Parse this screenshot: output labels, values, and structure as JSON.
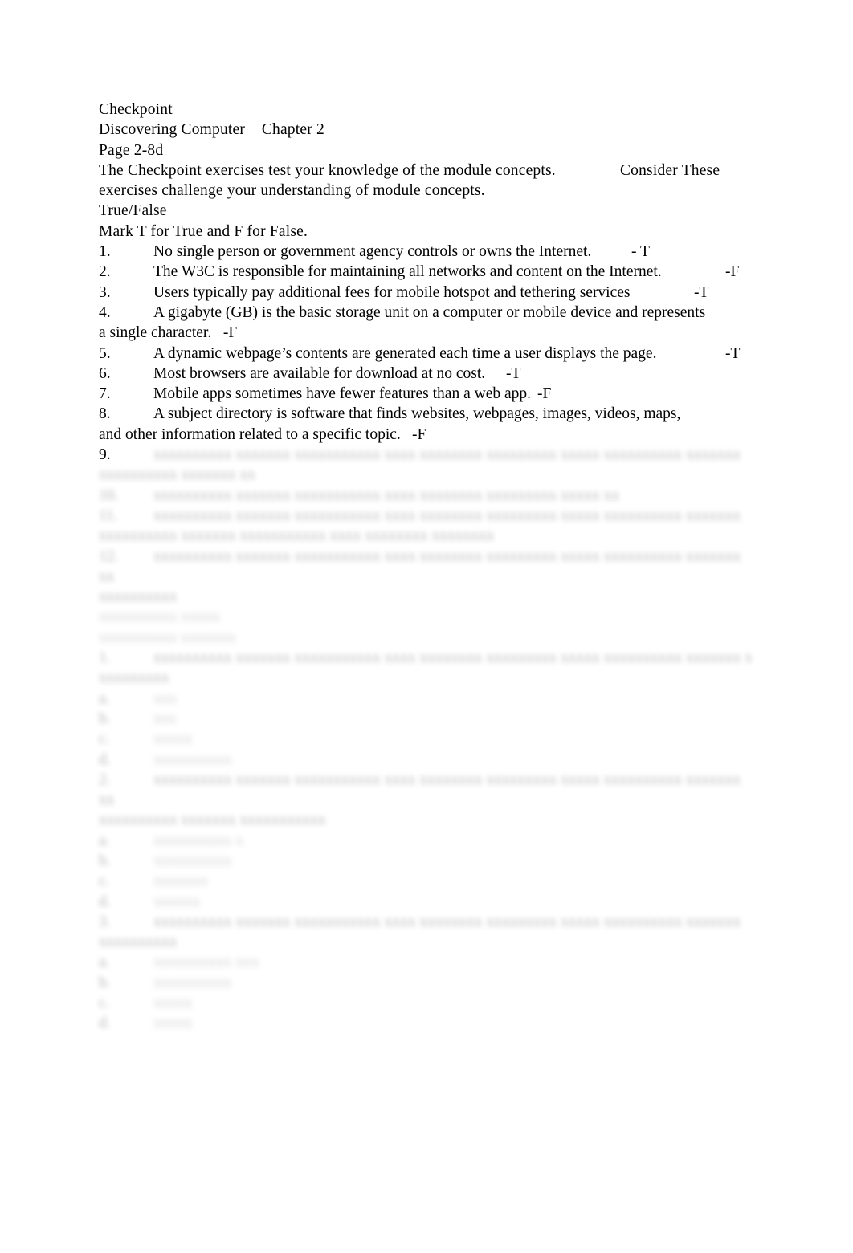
{
  "document": {
    "title_lines": [
      "Checkpoint",
      "Discovering Computer\tChapter 2",
      "Page 2-8d"
    ],
    "intro": [
      "The Checkpoint exercises test your knowledge of the module concepts.\t\tConsider These",
      "exercises challenge your understanding of module concepts."
    ],
    "section_true_false": {
      "heading": "True/False",
      "instruction": "Mark T for True and F for False.",
      "items": [
        {
          "number": "1.",
          "text": "No single person or government agency controls or owns the Internet.",
          "answer": "- T",
          "gap": "\t\t",
          "continuation": ""
        },
        {
          "number": "2.",
          "text": "The W3C is responsible for maintaining all networks and content on the Internet.",
          "answer": "-F",
          "gap": "\t\t",
          "continuation": ""
        },
        {
          "number": "3.",
          "text": "Users typically pay additional fees for mobile hotspot and tethering services",
          "answer": "-T",
          "gap": "\t\t",
          "continuation": ""
        },
        {
          "number": "4.",
          "text": "A gigabyte (GB) is the basic storage unit on a computer or mobile device and represents",
          "answer": "",
          "gap": "",
          "continuation": "a single character.   -F"
        },
        {
          "number": "5.",
          "text": "A dynamic webpage’s contents are generated each time a user displays the page.",
          "answer": "-T",
          "gap": "\t\t\t",
          "continuation": ""
        },
        {
          "number": "6.",
          "text": "Most browsers are available for download at no cost.",
          "answer": "-T",
          "gap": "\t",
          "continuation": ""
        },
        {
          "number": "7.",
          "text": "Mobile apps sometimes have fewer features than a web app.",
          "answer": "-F",
          "gap": "\t",
          "continuation": ""
        },
        {
          "number": "8.",
          "text": "A subject directory is software that finds websites, webpages, images, videos, maps,",
          "answer": "",
          "gap": "",
          "continuation": "and other information related to a specific topic.\t-F"
        }
      ]
    },
    "obscured_region": {
      "note_visible_number": "9.",
      "lines": [
        {
          "indent": "hanging",
          "number": "9.",
          "width": "92%",
          "level": "blur"
        },
        {
          "indent": "margin",
          "number": "",
          "width": "22%",
          "level": "blur"
        },
        {
          "indent": "hanging",
          "number": "10.",
          "width": "72%",
          "level": "blur"
        },
        {
          "indent": "hanging",
          "number": "11.",
          "width": "92%",
          "level": "blur"
        },
        {
          "indent": "margin",
          "number": "",
          "width": "56%",
          "level": "blur"
        },
        {
          "indent": "hanging",
          "number": "12.",
          "width": "94%",
          "level": "blur"
        },
        {
          "indent": "margin",
          "number": "",
          "width": "12%",
          "level": "blur"
        },
        {
          "indent": "margin",
          "number": "",
          "width": "17%",
          "level": "soft"
        },
        {
          "indent": "margin",
          "number": "",
          "width": "20%",
          "level": "soft"
        },
        {
          "indent": "hanging",
          "number": "1.",
          "width": "93%",
          "level": "blur"
        },
        {
          "indent": "margin",
          "number": "",
          "width": "10%",
          "level": "blur"
        },
        {
          "indent": "hanging",
          "number": "a.",
          "width": "3%",
          "level": "soft"
        },
        {
          "indent": "hanging",
          "number": "b.",
          "width": "4%",
          "level": "soft"
        },
        {
          "indent": "hanging",
          "number": "c.",
          "width": "6%",
          "level": "soft"
        },
        {
          "indent": "hanging",
          "number": "d.",
          "width": "13%",
          "level": "soft"
        },
        {
          "indent": "hanging",
          "number": "2.",
          "width": "94%",
          "level": "blur"
        },
        {
          "indent": "margin",
          "number": "",
          "width": "33%",
          "level": "blur"
        },
        {
          "indent": "hanging",
          "number": "a.",
          "width": "14%",
          "level": "soft"
        },
        {
          "indent": "hanging",
          "number": "b.",
          "width": "12%",
          "level": "soft"
        },
        {
          "indent": "hanging",
          "number": "c.",
          "width": "8%",
          "level": "soft"
        },
        {
          "indent": "hanging",
          "number": "d.",
          "width": "7%",
          "level": "soft"
        },
        {
          "indent": "hanging",
          "number": "3.",
          "width": "91%",
          "level": "blur"
        },
        {
          "indent": "margin",
          "number": "",
          "width": "12%",
          "level": "blur"
        },
        {
          "indent": "hanging",
          "number": "a.",
          "width": "16%",
          "level": "soft"
        },
        {
          "indent": "hanging",
          "number": "b.",
          "width": "11%",
          "level": "soft"
        },
        {
          "indent": "hanging",
          "number": "c.",
          "width": "6%",
          "level": "soft"
        },
        {
          "indent": "hanging",
          "number": "d.",
          "width": "6%",
          "level": "soft"
        }
      ]
    }
  },
  "colors": {
    "page_background": "#ffffff",
    "text": "#000000",
    "obscured_text": "#8a8a8a"
  }
}
